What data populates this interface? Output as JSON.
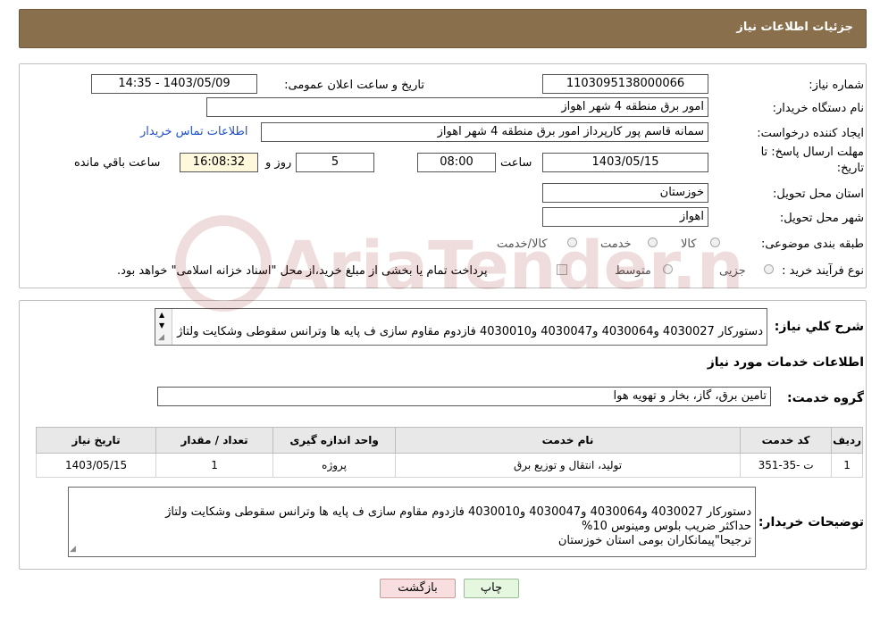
{
  "header": {
    "title": "جزئیات اطلاعات نیاز"
  },
  "form": {
    "need_number_label": "شماره نیاز:",
    "need_number": "1103095138000066",
    "announce_label": "تاریخ و ساعت اعلان عمومی:",
    "announce_value": "1403/05/09 - 14:35",
    "buyer_org_label": "نام دستگاه خریدار:",
    "buyer_org": "امور برق منطقه 4 شهر اهواز",
    "creator_label": "ایجاد کننده درخواست:",
    "creator": "سمانه قاسم پور کارپرداز امور برق منطقه 4 شهر اهواز",
    "contact_link": "اطلاعات تماس خریدار",
    "deadline_label_1": "مهلت ارسال پاسخ: تا",
    "deadline_label_2": "تاریخ:",
    "deadline_date": "1403/05/15",
    "time_label": "ساعت",
    "deadline_time": "08:00",
    "days_value": "5",
    "days_label": "روز و",
    "remaining_time": "16:08:32",
    "remaining_label": "ساعت باقي مانده",
    "province_label": "استان محل تحویل:",
    "province": "خوزستان",
    "city_label": "شهر محل تحویل:",
    "city": "اهواز",
    "category_label": "طبقه بندی موضوعی:",
    "category_options": [
      "کالا",
      "خدمت",
      "کالا/خدمت"
    ],
    "process_label": "نوع فرآیند خرید :",
    "process_options": [
      "جزیی",
      "متوسط"
    ],
    "payment_note": "پرداخت تمام یا بخشی از مبلغ خرید،از محل \"اسناد خزانه اسلامی\" خواهد بود."
  },
  "details": {
    "summary_label": "شرح کلي نياز:",
    "summary_text": "دستورکار 4030027 و4030064 و4030047 و4030010 فازدوم مقاوم سازی ف پایه ها وترانس سقوطی وشکایت ولتاژ",
    "services_heading": "اطلاعات خدمات مورد نياز",
    "service_group_label": "گروه خدمت:",
    "service_group": "تامین برق، گاز، بخار و تهویه هوا",
    "table": {
      "headers": [
        "رديف",
        "کد خدمت",
        "نام خدمت",
        "واحد اندازه گيری",
        "تعداد / مقدار",
        "تاريخ نياز"
      ],
      "rows": [
        [
          "1",
          "ت -35-351",
          "تولید، انتقال و توزیع برق",
          "پروژه",
          "1",
          "1403/05/15"
        ]
      ]
    },
    "buyer_notes_label": "توضيحات خريدار:",
    "buyer_notes": "دستورکار 4030027 و4030064 و4030047 و4030010 فازدوم مقاوم سازی ف پایه ها وترانس سقوطی وشکایت ولتاژ\nحداکثر ضریب بلوس ومینوس 10%\nترجیحا\"پیمانکاران بومی استان خوزستان"
  },
  "buttons": {
    "print": "چاپ",
    "back": "بازگشت"
  },
  "watermark": {
    "text": "AriaTender.neT"
  },
  "colors": {
    "header": "#8a6f4c",
    "link": "#1f4fd1",
    "back_button": "#f8dede",
    "print_button": "#e6f7df"
  }
}
